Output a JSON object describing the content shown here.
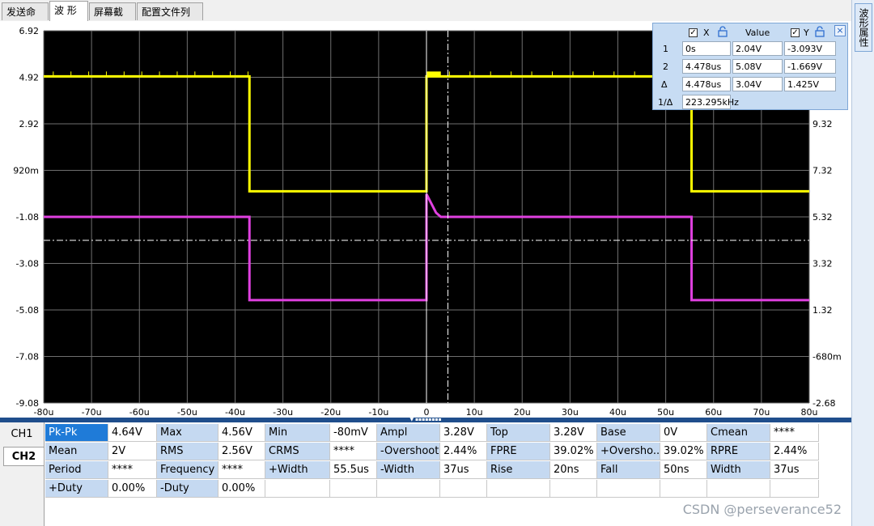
{
  "tabs": [
    {
      "label": "发送命令",
      "active": false
    },
    {
      "label": "波 形",
      "active": true
    },
    {
      "label": "屏幕截图",
      "active": false
    },
    {
      "label": "配置文件列表",
      "active": false
    }
  ],
  "side_tab": "波形属性",
  "plot": {
    "left_axis_labels": [
      "6.92",
      "4.92",
      "2.92",
      "920m",
      "-1.08",
      "-3.08",
      "-5.08",
      "-7.08",
      "-9.08"
    ],
    "right_axis_labels": [
      "9.32",
      "7.32",
      "5.32",
      "3.32",
      "1.32",
      "-680m",
      "-2.68"
    ],
    "x_axis_labels": [
      "-80u",
      "-70u",
      "-60u",
      "-50u",
      "-40u",
      "-30u",
      "-20u",
      "-10u",
      "0",
      "10u",
      "20u",
      "30u",
      "40u",
      "50u",
      "60u",
      "70u",
      "80u"
    ],
    "colors": {
      "background": "#000000",
      "grid": "#6f6f6f",
      "ch1": "#ffff00",
      "ch2": "#e040e0",
      "cursor": "#ffffff"
    }
  },
  "cursor_panel": {
    "x_header": "X",
    "value_header": "Value",
    "y_header": "Y",
    "rows": [
      {
        "label": "1",
        "x": "0s",
        "value": "2.04V",
        "y": "-3.093V"
      },
      {
        "label": "2",
        "x": "4.478us",
        "value": "5.08V",
        "y": "-1.669V"
      },
      {
        "label": "Δ",
        "x": "4.478us",
        "value": "3.04V",
        "y": "1.425V"
      },
      {
        "label": "1/Δ",
        "x": "223.295kHz"
      }
    ]
  },
  "channel_tabs": [
    {
      "label": "CH1",
      "active": false
    },
    {
      "label": "CH2",
      "active": true
    }
  ],
  "measurements": [
    [
      [
        "Pk-Pk",
        "4.64V"
      ],
      [
        "Max",
        "4.56V"
      ],
      [
        "Min",
        "-80mV"
      ],
      [
        "Ampl",
        "3.28V"
      ],
      [
        "Top",
        "3.28V"
      ],
      [
        "Base",
        "0V"
      ],
      [
        "Cmean",
        "****"
      ]
    ],
    [
      [
        "Mean",
        "2V"
      ],
      [
        "RMS",
        "2.56V"
      ],
      [
        "CRMS",
        "****"
      ],
      [
        "-Overshoot",
        "2.44%"
      ],
      [
        "FPRE",
        "39.02%"
      ],
      [
        "+Oversho...",
        "39.02%"
      ],
      [
        "RPRE",
        "2.44%"
      ]
    ],
    [
      [
        "Period",
        "****"
      ],
      [
        "Frequency",
        "****"
      ],
      [
        "+Width",
        "55.5us"
      ],
      [
        "-Width",
        "37us"
      ],
      [
        "Rise",
        "20ns"
      ],
      [
        "Fall",
        "50ns"
      ],
      [
        "Width",
        "37us"
      ]
    ],
    [
      [
        "+Duty",
        "0.00%"
      ],
      [
        "-Duty",
        "0.00%"
      ],
      [
        "",
        ""
      ],
      [
        "",
        ""
      ],
      [
        "",
        ""
      ],
      [
        "",
        ""
      ],
      [
        "",
        ""
      ]
    ]
  ],
  "watermark": "CSDN @perseverance52"
}
